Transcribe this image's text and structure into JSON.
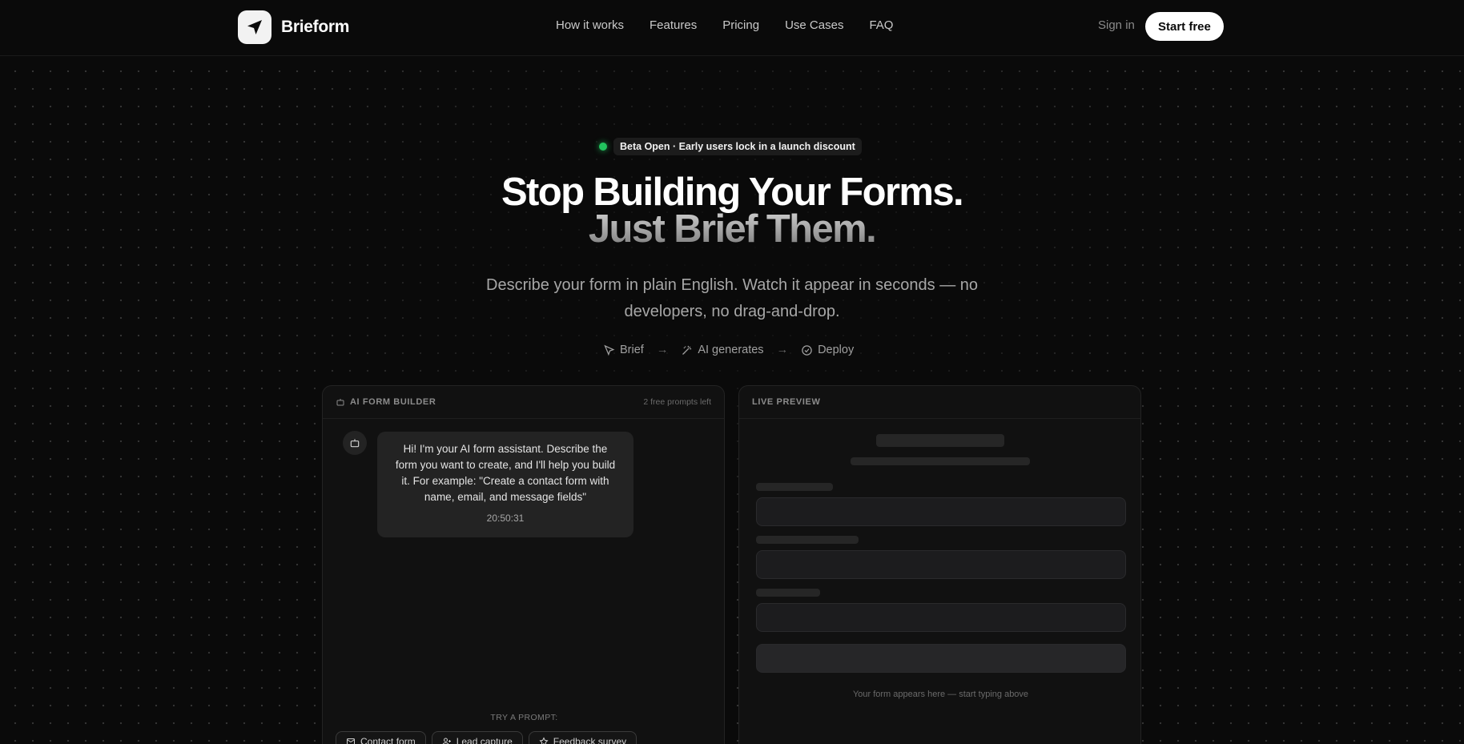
{
  "brand": {
    "name": "Brieform",
    "icon": "paper-plane-icon"
  },
  "nav": {
    "links": [
      "How it works",
      "Features",
      "Pricing",
      "Use Cases",
      "FAQ"
    ],
    "sign_in": "Sign in",
    "start_free": "Start free"
  },
  "hero": {
    "badge": "Beta Open · Early users lock in a launch discount",
    "title_line1": "Stop Building Your Forms.",
    "title_line2": "Just Brief Them.",
    "subtitle": "Describe your form in plain English. Watch it appear in seconds — no developers, no drag-and-drop.",
    "steps": [
      {
        "label": "Brief",
        "icon": "cursor-icon"
      },
      {
        "label": "AI generates",
        "icon": "magic-wand-icon"
      },
      {
        "label": "Deploy",
        "icon": "check-circle-icon"
      }
    ]
  },
  "builder": {
    "title": "AI FORM BUILDER",
    "prompts_left": "2 free prompts left",
    "message": "Hi! I'm your AI form assistant. Describe the form you want to create, and I'll help you build it. For example: \"Create a contact form with name, email, and message fields\"",
    "time": "20:50:31",
    "try_label": "TRY A PROMPT:",
    "prompts": [
      {
        "label": "Contact form",
        "icon": "mail-icon"
      },
      {
        "label": "Lead capture",
        "icon": "user-plus-icon"
      },
      {
        "label": "Feedback survey",
        "icon": "star-icon"
      }
    ]
  },
  "preview": {
    "title": "LIVE PREVIEW",
    "note": "Your form appears here — start typing above"
  },
  "colors": {
    "accent": "#22c55e",
    "background": "#0a0a0a",
    "panel": "#111111"
  }
}
